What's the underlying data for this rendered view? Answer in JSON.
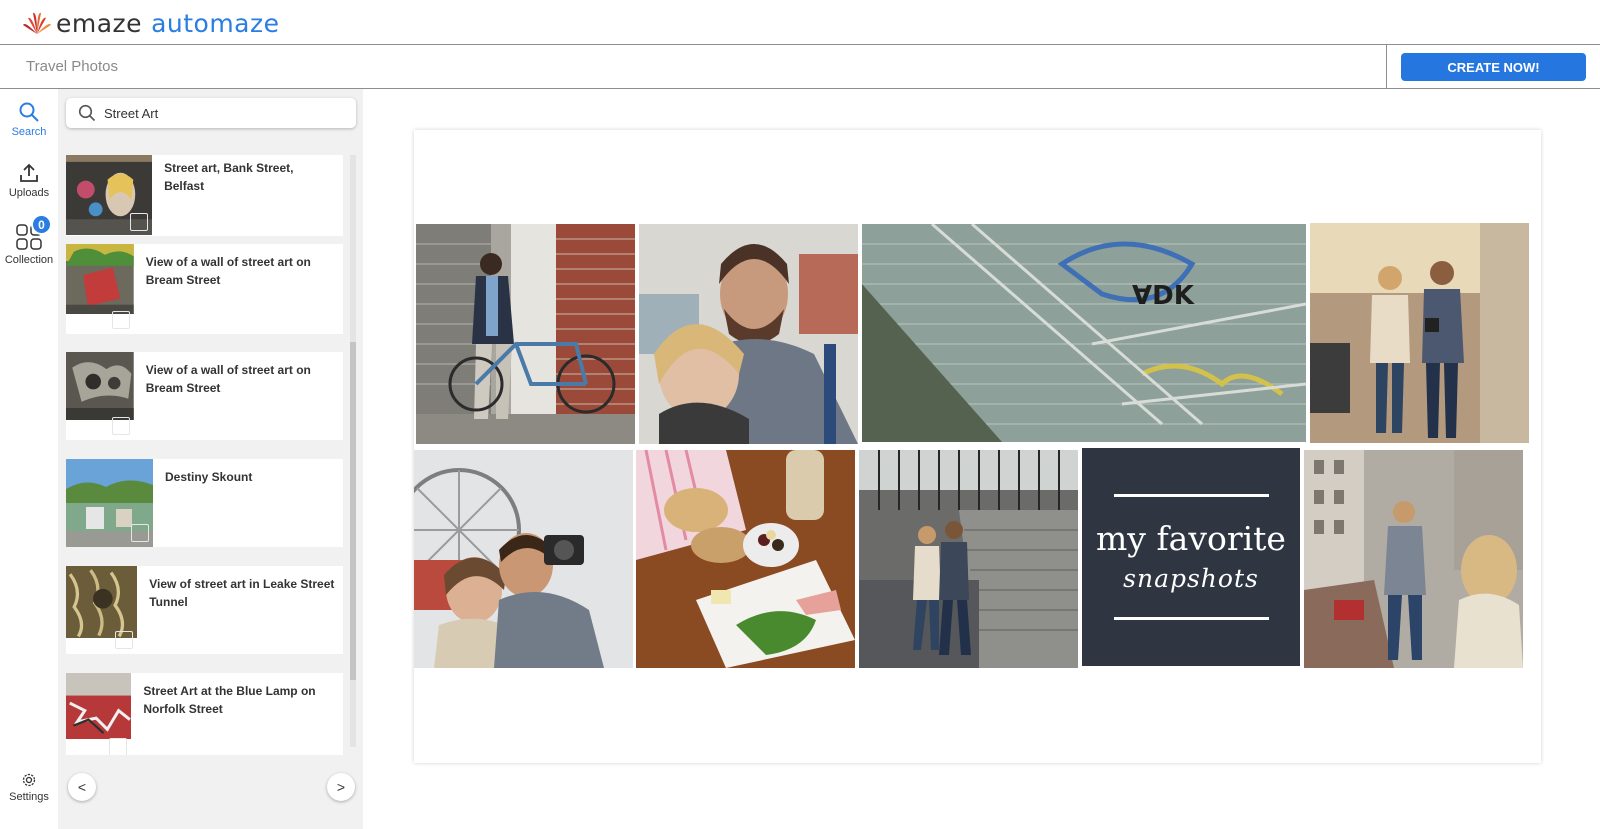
{
  "brand": {
    "word1": "emaze",
    "word2": "automaze",
    "accent": "#2a7de1"
  },
  "header": {
    "title": "Travel Photos",
    "create_label": "CREATE NOW!"
  },
  "rail": {
    "search": "Search",
    "uploads": "Uploads",
    "collection": "Collection",
    "collection_count": "0",
    "settings": "Settings"
  },
  "search": {
    "value": "Street Art"
  },
  "results": [
    {
      "label": "Street art, Bank Street, Belfast"
    },
    {
      "label": "View of a wall of street art on Bream Street"
    },
    {
      "label": "View of a wall of street art on Bream Street"
    },
    {
      "label": "Destiny Skount"
    },
    {
      "label": "View of street art in Leake Street Tunnel"
    },
    {
      "label": "Street Art at the Blue Lamp on Norfolk Street"
    }
  ],
  "pager": {
    "prev": "<",
    "next": ">"
  },
  "canvas": {
    "card_line1": "my favorite",
    "card_line2": "snapshots"
  }
}
